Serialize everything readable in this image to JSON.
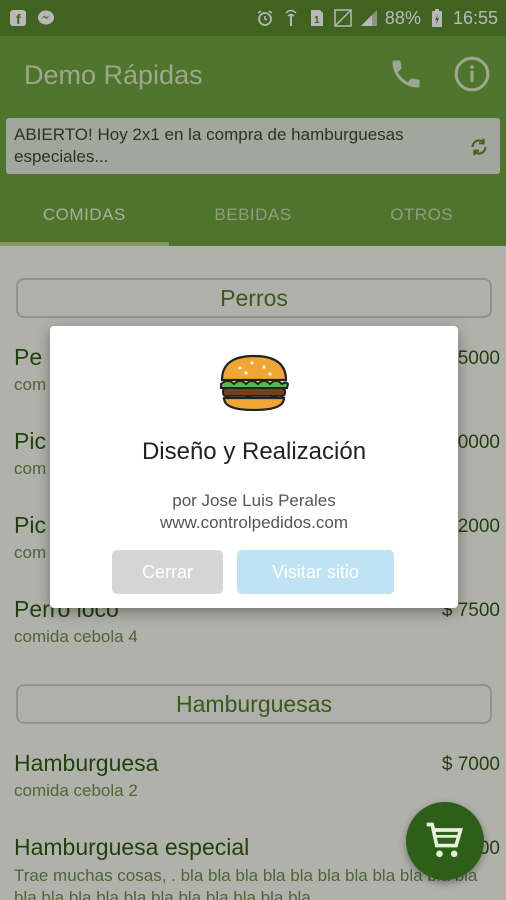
{
  "status_bar": {
    "battery": "88%",
    "time": "16:55",
    "icons": [
      "facebook-icon",
      "messenger-icon",
      "alarm-icon",
      "signal-boost-icon",
      "sim-icon",
      "no-signal-icon",
      "signal-icon",
      "battery-charging-icon"
    ]
  },
  "app": {
    "title": "Demo Rápidas",
    "announcement": "ABIERTO! Hoy 2x1 en la compra de hamburguesas especiales...",
    "tabs": [
      {
        "label": "COMIDAS",
        "active": true
      },
      {
        "label": "BEBIDAS",
        "active": false
      },
      {
        "label": "OTROS",
        "active": false
      }
    ]
  },
  "menu": {
    "categories": [
      {
        "name": "Perros",
        "items": [
          {
            "name": "Pe",
            "desc": "com",
            "price": "5000"
          },
          {
            "name": "Pic",
            "desc": "com",
            "price": "0000"
          },
          {
            "name": "Pic",
            "desc": "com",
            "price": "2000"
          },
          {
            "name": "Perro loco",
            "desc": "comida cebola 4",
            "price": "$ 7500"
          }
        ]
      },
      {
        "name": "Hamburguesas",
        "items": [
          {
            "name": "Hamburguesa",
            "desc": "comida cebola 2",
            "price": "$ 7000"
          },
          {
            "name": "Hamburguesa especial",
            "desc": "Trae muchas cosas, . bla bla bla bla bla bla bla bla bla bla bla bla bla bla bla bla bla bla bla bla bla bla",
            "price": "00"
          }
        ]
      }
    ]
  },
  "dialog": {
    "title": "Diseño y Realización",
    "author": "por Jose Luis Perales",
    "website": "www.controlpedidos.com",
    "close_label": "Cerrar",
    "visit_label": "Visitar sitio"
  },
  "colors": {
    "primary": "#6ea13c",
    "primary_dark": "#5a8a2e",
    "fab": "#2e5f18",
    "text_green": "#2f5a13"
  }
}
